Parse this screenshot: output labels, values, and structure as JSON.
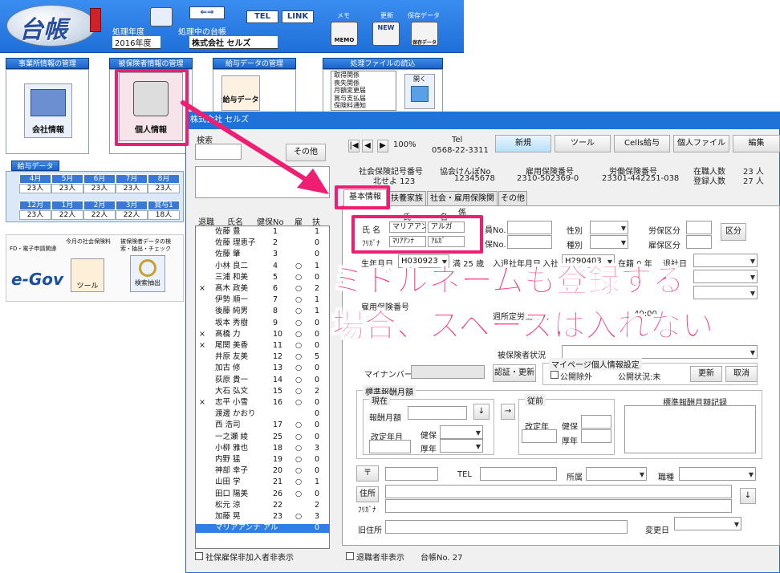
{
  "header": {
    "logo_text": "台帳",
    "year_label": "処理年度",
    "year_value": "2016年度",
    "current_ledger_label": "処理中の台帳",
    "company_value": "株式会社 セルズ",
    "tel_button": "TEL",
    "link_button": "LINK",
    "memo_label": "メモ",
    "memo_icon_text": "MEMO",
    "update_label": "更新",
    "update_icon_text": "NEW",
    "save_label": "保存データ",
    "save_icon_text": "保存データ"
  },
  "sections": {
    "office": "事業所情報の管理",
    "insured": "被保険者情報の管理",
    "salary": "給与データの管理",
    "files": "処理ファイルの読込",
    "company_info_button": "会社情報",
    "personal_info_button": "個人情報",
    "salary_data_button": "給与データ",
    "open_button": "開く"
  },
  "file_list": [
    "取得関係",
    "喪失関係",
    "月額変更届",
    "賞与支払届",
    "保険料通知"
  ],
  "salary_grid": {
    "title": "給与データ",
    "row1_headers": [
      "4月",
      "5月",
      "6月",
      "7月",
      "8月"
    ],
    "row1_values": [
      "23人",
      "23人",
      "23人",
      "23人",
      "23人"
    ],
    "row2_headers": [
      "12月",
      "1月",
      "2月",
      "3月",
      "賞与1"
    ],
    "row2_values": [
      "23人",
      "22人",
      "22人",
      "22人",
      "18人"
    ]
  },
  "shortcuts": {
    "fd_label": "FD・電子申請関連",
    "egov_text": "e-Gov",
    "social_ins_label": "今月の社会保険料",
    "tool_text": "ツール",
    "extract_label": "被保険者データの検索・抽出・チェック",
    "extract_text": "検索抽出"
  },
  "dialog": {
    "title": "株式会社 セルズ",
    "search_label": "検索",
    "other_button": "その他",
    "zoom": "100%",
    "tel_label": "Tel",
    "tel_value": "0568-22-3311",
    "buttons": {
      "new": "新規",
      "tool": "ツール",
      "cells_salary": "Cells給与",
      "personal_file": "個人ファイル",
      "edit": "編集"
    },
    "info": {
      "social_no_label": "社会保険記号番号",
      "social_no_value": "北せよ 123",
      "kyokai_label": "協会けんぽNo",
      "kyokai_value": "12345678",
      "employment_label": "雇用保険番号",
      "employment_value": "2310-502369-0",
      "labor_label": "労働保険番号",
      "labor_value": "23301-442251-038",
      "employed_count_label": "在職人数",
      "employed_count_value": "23 人",
      "registered_count_label": "登録人数",
      "registered_count_value": "27 人"
    },
    "tabs": [
      "基本情報",
      "扶養家族",
      "社会・雇用保険関係",
      "その他"
    ],
    "list_headers": {
      "retired": "退職",
      "name": "氏名",
      "ins_no": "健保No",
      "employ": "雇",
      "dep": "扶"
    },
    "employees": [
      {
        "mark": "",
        "name": "佐藤 豊",
        "no": "1",
        "emp": "",
        "dep": "1"
      },
      {
        "mark": "",
        "name": "佐藤 理恵子",
        "no": "2",
        "emp": "",
        "dep": "0"
      },
      {
        "mark": "",
        "name": "佐藤 肇",
        "no": "3",
        "emp": "",
        "dep": "0"
      },
      {
        "mark": "",
        "name": "小林 良二",
        "no": "4",
        "emp": "○",
        "dep": "1"
      },
      {
        "mark": "",
        "name": "三浦 和美",
        "no": "5",
        "emp": "○",
        "dep": "0"
      },
      {
        "mark": "×",
        "name": "髙木 政美",
        "no": "6",
        "emp": "○",
        "dep": "2"
      },
      {
        "mark": "",
        "name": "伊勢 順一",
        "no": "7",
        "emp": "○",
        "dep": "1"
      },
      {
        "mark": "",
        "name": "後藤 純男",
        "no": "8",
        "emp": "○",
        "dep": "1"
      },
      {
        "mark": "",
        "name": "坂本 秀樹",
        "no": "9",
        "emp": "○",
        "dep": "0"
      },
      {
        "mark": "×",
        "name": "髙橋 力",
        "no": "10",
        "emp": "○",
        "dep": "0"
      },
      {
        "mark": "×",
        "name": "尾関 美香",
        "no": "11",
        "emp": "○",
        "dep": "0"
      },
      {
        "mark": "",
        "name": "井原 友美",
        "no": "12",
        "emp": "○",
        "dep": "5"
      },
      {
        "mark": "",
        "name": "加古 修",
        "no": "13",
        "emp": "○",
        "dep": "0"
      },
      {
        "mark": "",
        "name": "荻原 貴一",
        "no": "14",
        "emp": "○",
        "dep": "0"
      },
      {
        "mark": "",
        "name": "大石 弘文",
        "no": "15",
        "emp": "○",
        "dep": "2"
      },
      {
        "mark": "×",
        "name": "志平 小雪",
        "no": "16",
        "emp": "○",
        "dep": "0"
      },
      {
        "mark": "",
        "name": "渡邊 かおり",
        "no": "",
        "emp": "",
        "dep": "0"
      },
      {
        "mark": "",
        "name": "西 浩司",
        "no": "17",
        "emp": "○",
        "dep": "0"
      },
      {
        "mark": "",
        "name": "一之瀬 綾",
        "no": "25",
        "emp": "○",
        "dep": "0"
      },
      {
        "mark": "",
        "name": "小柳 雅也",
        "no": "18",
        "emp": "○",
        "dep": "3"
      },
      {
        "mark": "",
        "name": "内野 猛",
        "no": "19",
        "emp": "○",
        "dep": "0"
      },
      {
        "mark": "",
        "name": "神部 幸子",
        "no": "20",
        "emp": "○",
        "dep": "0"
      },
      {
        "mark": "",
        "name": "山田 学",
        "no": "21",
        "emp": "○",
        "dep": "1"
      },
      {
        "mark": "",
        "name": "田口 陽美",
        "no": "26",
        "emp": "○",
        "dep": "0"
      },
      {
        "mark": "",
        "name": "松元 涼",
        "no": "22",
        "emp": "",
        "dep": "2"
      },
      {
        "mark": "",
        "name": "加藤 晃",
        "no": "23",
        "emp": "○",
        "dep": "3"
      },
      {
        "mark": "",
        "name": "マリアアンナ アル",
        "no": "",
        "emp": "",
        "dep": "0"
      }
    ],
    "form": {
      "name_label": "氏 名",
      "furigana_label": "ﾌﾘｶﾞﾅ",
      "sei_label": "氏",
      "mei_label": "名",
      "sei_value": "マリアアンナ",
      "mei_value": "アルガ",
      "sei_kana": "ﾏﾘｱｱﾝﾅ",
      "mei_kana": "ｱﾙｶﾞ",
      "personal_no_label": "員No.",
      "ins_no_label": "保No.",
      "gender_label": "性別",
      "type_label": "種別",
      "labor_class_label": "労保区分",
      "employ_class_label": "雇保区分",
      "class_button": "区分",
      "birth_label": "生年月日",
      "birth_value": "H030923",
      "age_value": "満 25 歳",
      "hire_label": "入退社年月日",
      "hire_in_label": "入社",
      "hire_value": "H290403",
      "tenure_value": "在籍 0 年",
      "retire_label": "退社日",
      "emp_ins_label": "雇用保険番号",
      "work_hours_label": "週所定労働時間",
      "work_hours_value": "40:00",
      "insured_status_label": "被保険者状況",
      "mynumber_label": "マイナンバー",
      "auth_button": "認証・更新",
      "mypage_legend": "マイページ個人情報設定",
      "public_exclude_label": "公開除外",
      "public_status": "公開状況:未",
      "update_button": "更新",
      "cancel_button": "取消",
      "std_legend": "標準報酬月額",
      "current_legend": "現在",
      "std_amount_label": "報酬月額",
      "revision_label": "改定年月",
      "health_label": "健保",
      "pension_label": "厚年",
      "before_legend": "従前",
      "revision_year_label": "改定年",
      "record_label": "標準報酬月額記録",
      "postal_button": "〒",
      "tel_label": "TEL",
      "dept_label": "所属",
      "job_label": "職種",
      "address_button": "住所",
      "address_kana_label": "ﾌﾘｶﾞﾅ",
      "old_address_label": "旧住所",
      "change_date_label": "変更日"
    },
    "footer": {
      "unenrolled_label": "社保雇保非加入者非表示",
      "retired_label": "退職者非表示",
      "ledger_no": "台帳No.  27"
    }
  },
  "annotation": {
    "line1": "ミドルネームも登録する",
    "line2": "場合、スペースは入れない"
  },
  "colors": {
    "accent": "#ee1e72",
    "header_blue": "#1f73d8",
    "selected_row": "#2f7fe6"
  }
}
